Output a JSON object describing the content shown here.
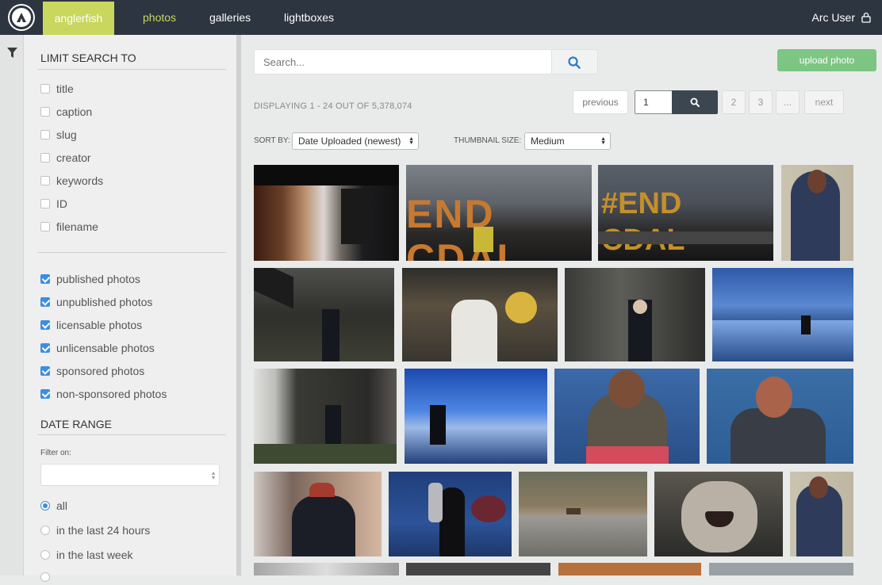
{
  "nav": {
    "brand": "anglerfish",
    "items": [
      "photos",
      "galleries",
      "lightboxes"
    ],
    "user": "Arc User"
  },
  "sidebar": {
    "limit_heading": "LIMIT SEARCH TO",
    "fields": [
      "title",
      "caption",
      "slug",
      "creator",
      "keywords",
      "ID",
      "filename"
    ],
    "photo_filters": [
      {
        "label": "published photos",
        "checked": true
      },
      {
        "label": "unpublished photos",
        "checked": true
      },
      {
        "label": "licensable photos",
        "checked": true
      },
      {
        "label": "unlicensable photos",
        "checked": true
      },
      {
        "label": "sponsored photos",
        "checked": true
      },
      {
        "label": "non-sponsored photos",
        "checked": true
      }
    ],
    "date_heading": "DATE RANGE",
    "filter_on_label": "Filter on:",
    "ranges": [
      {
        "label": "all",
        "selected": true
      },
      {
        "label": "in the last 24 hours",
        "selected": false
      },
      {
        "label": "in the last week",
        "selected": false
      }
    ]
  },
  "main": {
    "search_placeholder": "Search...",
    "upload_label": "upload photo",
    "display_text": "DISPLAYING 1 - 24 OUT OF 5,378,074",
    "pagination": {
      "previous": "previous",
      "current": "1",
      "pages": [
        "2",
        "3",
        "..."
      ],
      "next": "next"
    },
    "sort_label": "SORT BY:",
    "sort_value": "Date Uploaded (newest)",
    "thumb_label": "THUMBNAIL SIZE:",
    "thumb_value": "Medium"
  },
  "colors": {
    "topbar": "#2c3540",
    "brand": "#c9d75e",
    "accent": "#3d8ee0",
    "upload": "#7dc583"
  },
  "icons": {
    "logo": "arc-logo-icon",
    "user": "lock-icon",
    "filter": "funnel-icon",
    "search": "magnifier-icon"
  },
  "thumbnails": [
    {
      "name": "dark-interior-window"
    },
    {
      "name": "end-coal-letters"
    },
    {
      "name": "end-coal-night"
    },
    {
      "name": "officer-portrait"
    },
    {
      "name": "man-helicopter-lawn"
    },
    {
      "name": "baseball-player-crowd"
    },
    {
      "name": "man-walking-trees"
    },
    {
      "name": "cyclist-flood-water"
    },
    {
      "name": "man-walking-garden"
    },
    {
      "name": "figure-silhouette-water"
    },
    {
      "name": "rapper-gesture"
    },
    {
      "name": "broadcaster-headphones"
    },
    {
      "name": "man-red-cap-crowd"
    },
    {
      "name": "woman-trophy"
    },
    {
      "name": "animal-road"
    },
    {
      "name": "cougar-cub"
    },
    {
      "name": "officer-portrait-2"
    }
  ]
}
